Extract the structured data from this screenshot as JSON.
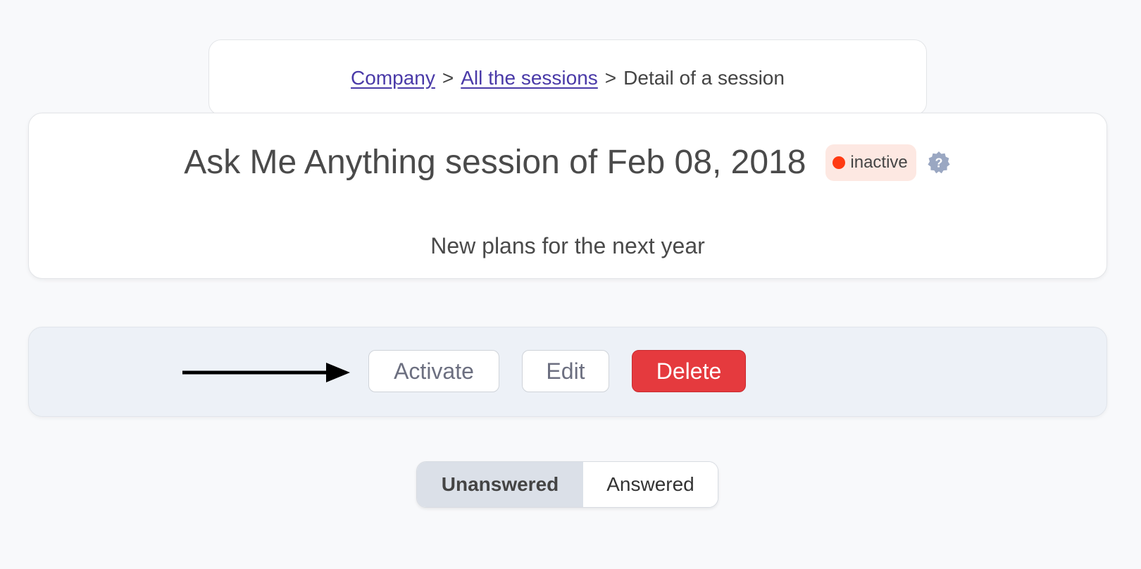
{
  "breadcrumb": {
    "company": "Company",
    "separator_1": ">",
    "sessions": "All the sessions",
    "separator_2": ">",
    "current": "Detail of a session"
  },
  "session": {
    "title": "Ask Me Anything session of Feb 08, 2018",
    "status": "inactive",
    "status_color": "#ff3a12",
    "help_icon": "question-badge-icon",
    "description": "New plans for the next year"
  },
  "actions": {
    "activate_label": "Activate",
    "edit_label": "Edit",
    "delete_label": "Delete",
    "delete_color": "#e53a3e"
  },
  "filter": {
    "options": [
      "Unanswered",
      "Answered"
    ],
    "selected": "Unanswered"
  }
}
